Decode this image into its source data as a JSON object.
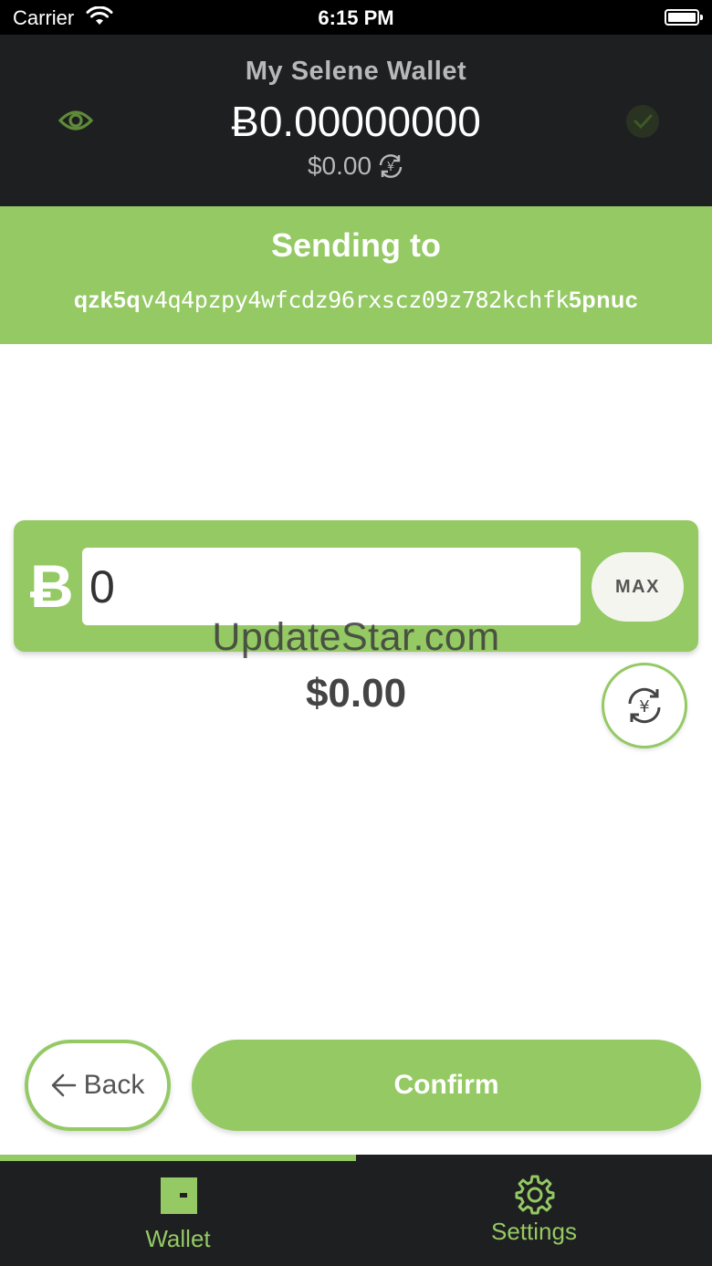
{
  "status_bar": {
    "carrier": "Carrier",
    "time": "6:15 PM"
  },
  "header": {
    "wallet_name": "My Selene Wallet",
    "balance_crypto": "Ƀ0.00000000",
    "balance_fiat": "$0.00"
  },
  "send": {
    "title": "Sending to",
    "address_prefix": "qzk5q",
    "address_middle": "v4q4pzpy4wfcdz96rxscz09z782kchfk",
    "address_suffix": "5pnuc"
  },
  "amount": {
    "currency_symbol": "Ƀ",
    "value": "0",
    "max_label": "MAX",
    "fiat_equivalent": "$0.00"
  },
  "watermark": "UpdateStar.com",
  "actions": {
    "back_label": "Back",
    "confirm_label": "Confirm"
  },
  "tabs": [
    {
      "label": "Wallet",
      "icon": "wallet-icon",
      "active": true
    },
    {
      "label": "Settings",
      "icon": "gear-icon",
      "active": false
    }
  ],
  "colors": {
    "accent": "#94c964",
    "header_bg": "#1e1f20",
    "tab_bar_bg": "#1e1f20"
  }
}
